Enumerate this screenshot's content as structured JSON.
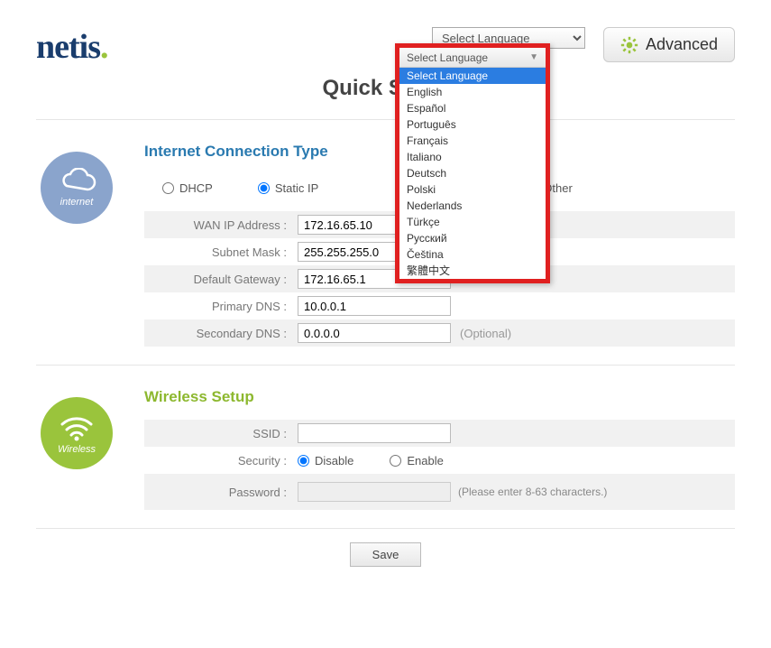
{
  "logo_text": "netis",
  "header": {
    "lang_select_placeholder": "Select Language",
    "advanced_label": "Advanced"
  },
  "page_title": "Quick Setup",
  "internet": {
    "title": "Internet Connection Type",
    "badge_label": "internet",
    "types": {
      "dhcp": "DHCP",
      "static": "Static IP",
      "other": "Other"
    },
    "selected_type": "static",
    "fields": {
      "wan_ip_label": "WAN IP Address :",
      "wan_ip_value": "172.16.65.10",
      "subnet_label": "Subnet Mask :",
      "subnet_value": "255.255.255.0",
      "gateway_label": "Default Gateway :",
      "gateway_value": "172.16.65.1",
      "pri_dns_label": "Primary DNS :",
      "pri_dns_value": "10.0.0.1",
      "sec_dns_label": "Secondary DNS :",
      "sec_dns_value": "0.0.0.0",
      "optional_text": "(Optional)"
    }
  },
  "wireless": {
    "title": "Wireless Setup",
    "badge_label": "Wireless",
    "ssid_label": "SSID :",
    "ssid_value": "",
    "security_label": "Security :",
    "sec_disable": "Disable",
    "sec_enable": "Enable",
    "password_label": "Password :",
    "password_hint": "(Please enter 8-63 characters.)"
  },
  "save_label": "Save",
  "language_dropdown": {
    "header": "Select Language",
    "items": [
      "Select Language",
      "English",
      "Español",
      "Português",
      "Français",
      "Italiano",
      "Deutsch",
      "Polski",
      "Nederlands",
      "Türkçe",
      "Русский",
      "Čeština",
      "繁體中文"
    ],
    "selected_index": 0
  }
}
